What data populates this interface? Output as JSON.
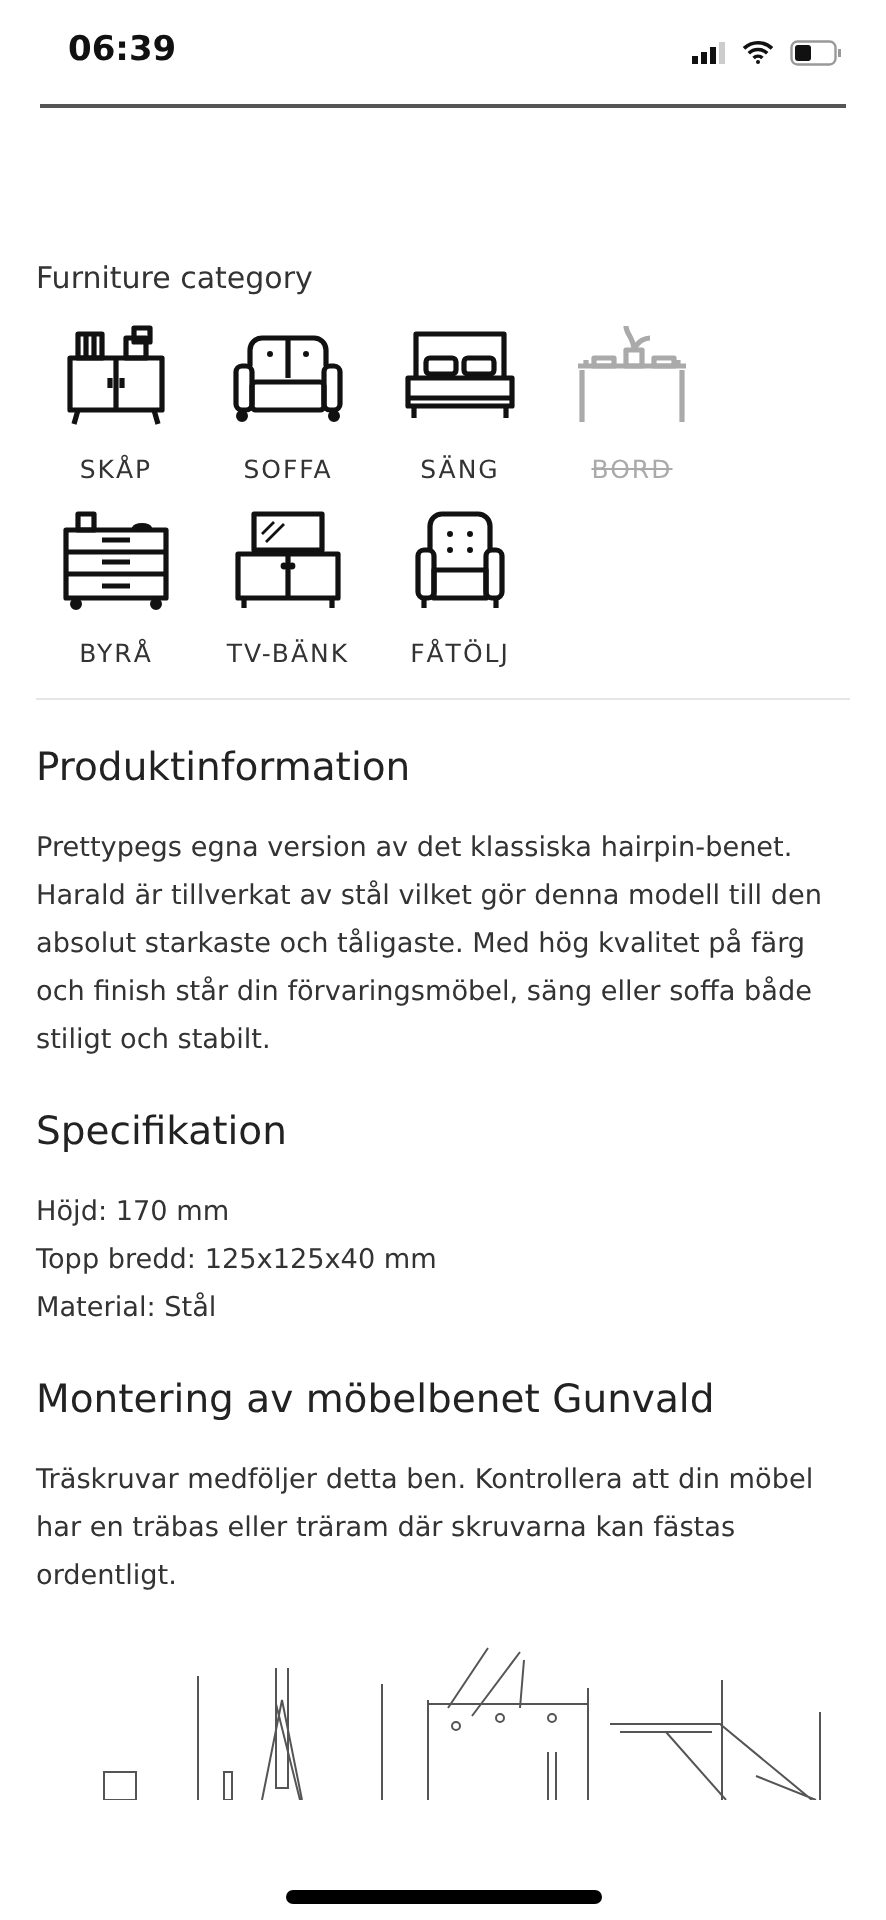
{
  "status_bar": {
    "time": "06:39"
  },
  "category": {
    "title": "Furniture category",
    "items": [
      {
        "label": "SKÅP",
        "kind": "cabinet",
        "disabled": false
      },
      {
        "label": "SOFFA",
        "kind": "sofa",
        "disabled": false
      },
      {
        "label": "SÄNG",
        "kind": "bed",
        "disabled": false
      },
      {
        "label": "BORD",
        "kind": "table",
        "disabled": true
      },
      {
        "label": "BYRÅ",
        "kind": "dresser",
        "disabled": false
      },
      {
        "label": "TV-BÄNK",
        "kind": "tv",
        "disabled": false
      },
      {
        "label": "FÅTÖLJ",
        "kind": "armchair",
        "disabled": false
      }
    ]
  },
  "sections": [
    {
      "title": "Produktinformation",
      "lines": [
        "Prettypegs egna version av det klassiska hairpin-benet. Harald är tillverkat av stål vilket gör denna modell till den absolut starkaste och tåligaste. Med hög kvalitet på färg och finish står din förvaringsmöbel, säng eller soffa både stiligt och stabilt."
      ]
    },
    {
      "title": "Specifikation",
      "lines": [
        "Höjd: 170 mm",
        "Topp bredd: 125x125x40 mm",
        "Material: Stål"
      ]
    },
    {
      "title": "Montering av möbelbenet Gunvald",
      "lines": [
        "Träskruvar medföljer detta ben. Kontrollera att din möbel har en träbas eller träram där skruvarna kan fästas ordentligt."
      ]
    }
  ]
}
